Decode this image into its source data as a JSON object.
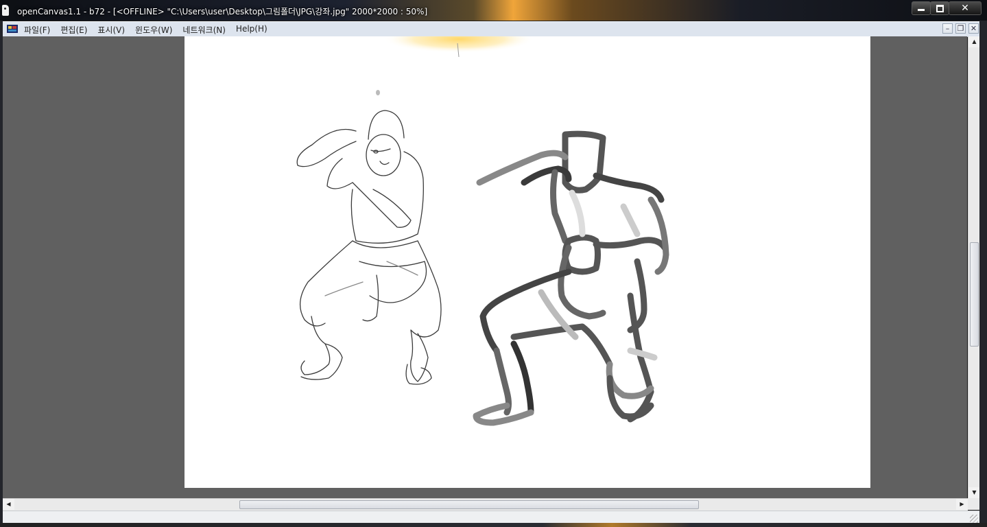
{
  "window": {
    "title": "openCanvas1.1 - b72 - [<OFFLINE>  \"C:\\Users\\user\\Desktop\\그림폴더\\JPG\\강좌.jpg\" 2000*2000 :  50%]",
    "minimize_icon": "minimize-icon",
    "maximize_icon": "maximize-icon",
    "close_glyph": "✕"
  },
  "menubar": {
    "items": [
      {
        "label": "파일(F)"
      },
      {
        "label": "편집(E)"
      },
      {
        "label": "표시(V)"
      },
      {
        "label": "윈도우(W)"
      },
      {
        "label": "네트워크(N)"
      },
      {
        "label": "Help(H)"
      }
    ],
    "mdi": {
      "minimize": "–",
      "restore": "❐",
      "close": "✕"
    }
  },
  "scrollbars": {
    "up_arrow": "▲",
    "down_arrow": "▼",
    "left_arrow": "◀",
    "right_arrow": "▶"
  },
  "colors": {
    "workspace_bg": "#606060",
    "canvas_bg": "#ffffff",
    "menubar_bg": "#dde4ee"
  }
}
